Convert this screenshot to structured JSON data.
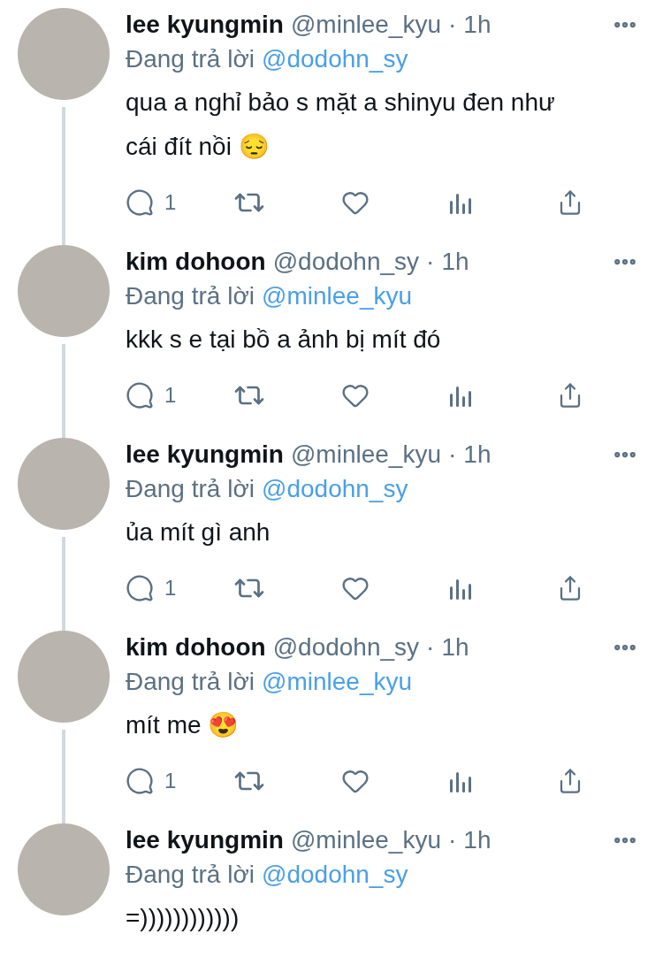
{
  "tweets": [
    {
      "name": "lee kyungmin",
      "handle": "@minlee_kyu",
      "separator": "·",
      "time": "1h",
      "reply_label": "Đang trả lời",
      "reply_to": "@dodohn_sy",
      "body": "qua a nghỉ bảo s mặt a shinyu đen như cái đít nồi 😔",
      "reply_count": "1",
      "connected": true
    },
    {
      "name": "kim dohoon",
      "handle": "@dodohn_sy",
      "separator": "·",
      "time": "1h",
      "reply_label": "Đang trả lời",
      "reply_to": "@minlee_kyu",
      "body": "kkk s e tại bồ a ảnh bị mít đó",
      "reply_count": "1",
      "connected": true
    },
    {
      "name": "lee kyungmin",
      "handle": "@minlee_kyu",
      "separator": "·",
      "time": "1h",
      "reply_label": "Đang trả lời",
      "reply_to": "@dodohn_sy",
      "body": "ủa mít gì anh",
      "reply_count": "1",
      "connected": true
    },
    {
      "name": "kim dohoon",
      "handle": "@dodohn_sy",
      "separator": "·",
      "time": "1h",
      "reply_label": "Đang trả lời",
      "reply_to": "@minlee_kyu",
      "body": "mít me 😍",
      "reply_count": "1",
      "connected": true
    },
    {
      "name": "lee kyungmin",
      "handle": "@minlee_kyu",
      "separator": "·",
      "time": "1h",
      "reply_label": "Đang trả lời",
      "reply_to": "@dodohn_sy",
      "body": "=))))))))))))",
      "connected": false
    }
  ]
}
